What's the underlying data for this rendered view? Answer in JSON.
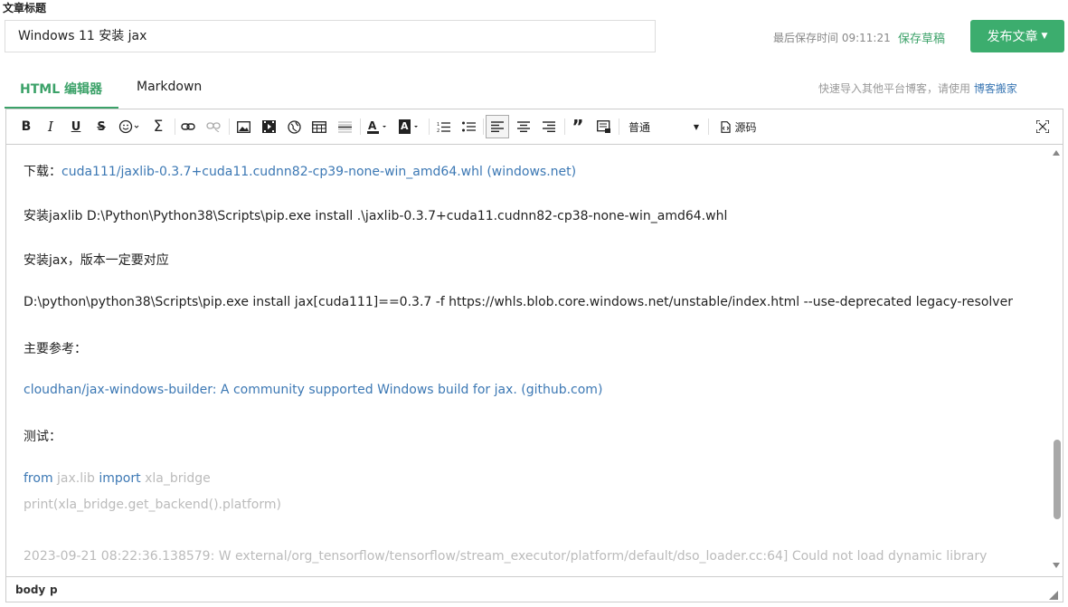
{
  "header": {
    "title_label": "文章标题",
    "title_value": "Windows 11 安装 jax",
    "saved_time": "最后保存时间 09:11:21",
    "save_draft": "保存草稿",
    "publish": "发布文章"
  },
  "tabs": [
    {
      "label": "HTML 编辑器",
      "active": true
    },
    {
      "label": "Markdown",
      "active": false
    }
  ],
  "import_hint": {
    "text": "快速导入其他平台博客，请使用",
    "link": "博客搬家"
  },
  "toolbar": {
    "icons": [
      "bold-icon",
      "italic-icon",
      "underline-icon",
      "strikethrough-icon",
      "emoji-icon",
      "formula-icon",
      "link-icon",
      "unlink-icon",
      "image-icon",
      "video-icon",
      "globe-icon",
      "table-icon",
      "horizontal-rule-icon",
      "font-color-icon",
      "background-color-icon",
      "ordered-list-icon",
      "unordered-list-icon",
      "align-left-icon",
      "align-center-icon",
      "align-right-icon",
      "quote-icon",
      "code-block-icon",
      "source-icon",
      "fullscreen-icon"
    ],
    "format_select": "普通",
    "source_label": "源码"
  },
  "content": {
    "download_label": "下载：",
    "download_link": "cuda111/jaxlib-0.3.7+cuda11.cudnn82-cp39-none-win_amd64.whl (windows.net)",
    "line2": "安装jaxlib D:\\Python\\Python38\\Scripts\\pip.exe install .\\jaxlib-0.3.7+cuda11.cudnn82-cp38-none-win_amd64.whl",
    "line3": "安装jax，版本一定要对应",
    "line4": "D:\\python\\python38\\Scripts\\pip.exe install jax[cuda111]==0.3.7 -f https://whls.blob.core.windows.net/unstable/index.html --use-deprecated legacy-resolver",
    "line5": "主要参考：",
    "ref_link": "cloudhan/jax-windows-builder: A community supported Windows build for jax. (github.com)",
    "line7": "测试：",
    "code_from": "from",
    "code_module": "jax.lib",
    "code_import": "import",
    "code_name": "xla_bridge",
    "code_line2": "print(xla_bridge.get_backend().platform)",
    "log_line": "2023-09-21 08:22:36.138579: W external/org_tensorflow/tensorflow/stream_executor/platform/default/dso_loader.cc:64] Could not load dynamic library"
  },
  "statusbar": {
    "path1": "body",
    "path2": "p"
  },
  "colors": {
    "accent": "#3ca269",
    "link": "#3c78b4",
    "publish_bg": "#3cad6e"
  }
}
